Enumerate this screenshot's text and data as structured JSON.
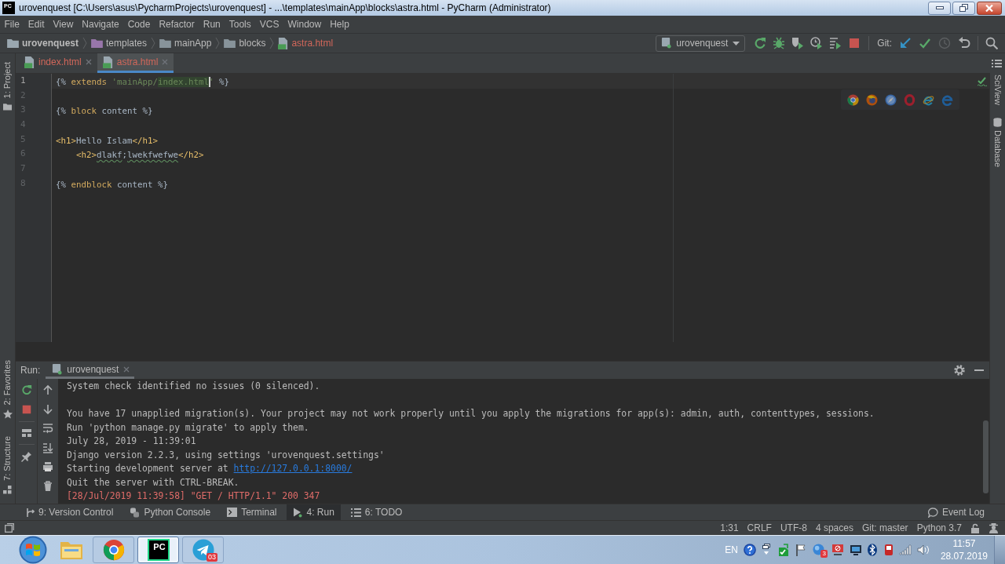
{
  "title_bar": {
    "logo": "PC",
    "title": "urovenquest [C:\\Users\\asus\\PycharmProjects\\urovenquest] - ...\\templates\\mainApp\\blocks\\astra.html - PyCharm (Administrator)"
  },
  "menu": [
    "File",
    "Edit",
    "View",
    "Navigate",
    "Code",
    "Refactor",
    "Run",
    "Tools",
    "VCS",
    "Window",
    "Help"
  ],
  "navigation_bar": {
    "breadcrumbs": [
      {
        "label": "urovenquest",
        "kind": "project"
      },
      {
        "label": "templates",
        "kind": "templates"
      },
      {
        "label": "mainApp",
        "kind": "folder"
      },
      {
        "label": "blocks",
        "kind": "folder"
      },
      {
        "label": "astra.html",
        "kind": "file"
      }
    ],
    "run_configuration": "urovenquest",
    "vcs_label": "Git:",
    "vcs_actions": [
      {
        "kind": "update",
        "disabled": false
      },
      {
        "kind": "commit",
        "disabled": false
      },
      {
        "kind": "history",
        "disabled": true
      },
      {
        "kind": "rollback",
        "disabled": false
      }
    ]
  },
  "tool_strips": {
    "left_top": [
      {
        "label": "1: Project",
        "kind": "project"
      }
    ],
    "left_bottom": [
      {
        "label": "2: Favorites",
        "kind": "favorites"
      },
      {
        "label": "7: Structure",
        "kind": "structure"
      }
    ],
    "right": [
      {
        "label": "SciView",
        "kind": "sciview"
      },
      {
        "label": "Database",
        "kind": "database"
      }
    ]
  },
  "editor": {
    "tabs": [
      {
        "label": "index.html",
        "selected": false
      },
      {
        "label": "astra.html",
        "selected": true
      }
    ],
    "lines": [
      {
        "number": "1",
        "tokens": [
          {
            "kind": "plain",
            "text": "{% "
          },
          {
            "kind": "keyword",
            "text": "extends"
          },
          {
            "kind": "string",
            "text": " 'mainApp/"
          },
          {
            "kind": "match",
            "text": "index.html"
          },
          {
            "kind": "string",
            "text": "'",
            "caret": true
          },
          {
            "kind": "plain",
            "text": " %}"
          }
        ]
      },
      {
        "number": "2"
      },
      {
        "number": "3",
        "tokens": [
          {
            "kind": "plain",
            "text": "{% "
          },
          {
            "kind": "keyword",
            "text": "block"
          },
          {
            "kind": "plain",
            "text": " content %}"
          }
        ]
      },
      {
        "number": "4"
      },
      {
        "number": "5",
        "tokens": [
          {
            "kind": "tag",
            "text": "<h1>"
          },
          {
            "kind": "plain",
            "text": "Hello Islam"
          },
          {
            "kind": "tag",
            "text": "</h1>"
          }
        ]
      },
      {
        "number": "6",
        "tokens": [
          {
            "kind": "tag",
            "text": "    <h2>"
          },
          {
            "kind": "typo",
            "text": "dlakf"
          },
          {
            "kind": "plain",
            "text": ";"
          },
          {
            "kind": "typo",
            "text": "lwekfwefwe"
          },
          {
            "kind": "tag",
            "text": "</h2>"
          }
        ]
      },
      {
        "number": "7"
      },
      {
        "number": "8",
        "tokens": [
          {
            "kind": "plain",
            "text": "{% "
          },
          {
            "kind": "keyword",
            "text": "endblock"
          },
          {
            "kind": "plain",
            "text": " content %}"
          }
        ]
      }
    ]
  },
  "run_panel": {
    "title": "Run:",
    "tabs": [
      {
        "label": "urovenquest",
        "selected": true
      }
    ],
    "console": [
      {
        "kind": "output",
        "text": "System check identified no issues (0 silenced)."
      },
      {
        "kind": "blank"
      },
      {
        "kind": "output",
        "text": "You have 17 unapplied migration(s). Your project may not work properly until you apply the migrations for app(s): admin, auth, contenttypes, sessions."
      },
      {
        "kind": "output",
        "text": "Run 'python manage.py migrate' to apply them."
      },
      {
        "kind": "output",
        "text": "July 28, 2019 - 11:39:01"
      },
      {
        "kind": "output",
        "text": "Django version 2.2.3, using settings 'urovenquest.settings'"
      },
      {
        "kind": "output",
        "text": "Starting development server at ",
        "link": "http://127.0.0.1:8000/"
      },
      {
        "kind": "output",
        "text": "Quit the server with CTRL-BREAK."
      },
      {
        "kind": "request",
        "text": "[28/Jul/2019 11:39:58] \"GET / HTTP/1.1\" 200 347"
      }
    ]
  },
  "tool_window_bar": {
    "tabs": [
      {
        "label": "9: Version Control",
        "kind": "vcs",
        "selected": false
      },
      {
        "label": "Python Console",
        "kind": "python",
        "selected": false
      },
      {
        "label": "Terminal",
        "kind": "terminal",
        "selected": false
      },
      {
        "label": "4: Run",
        "kind": "run",
        "selected": true
      },
      {
        "label": "6: TODO",
        "kind": "todo",
        "selected": false
      }
    ],
    "event_log": "Event Log"
  },
  "status_bar": {
    "items": [
      "1:31",
      "CRLF",
      "UTF-8",
      "4 spaces",
      "Git: master",
      "Python 3.7"
    ]
  },
  "taskbar": {
    "apps": [
      {
        "kind": "explorer",
        "running": false,
        "selected": false
      },
      {
        "kind": "chrome",
        "running": true,
        "selected": false
      },
      {
        "kind": "pycharm",
        "running": true,
        "selected": true,
        "logo": "PC"
      },
      {
        "kind": "telegram",
        "running": true,
        "selected": false,
        "badge": "03"
      }
    ],
    "tray": {
      "language": "EN",
      "notification_badge": "3",
      "time": "11:57",
      "date": "28.07.2019"
    }
  }
}
